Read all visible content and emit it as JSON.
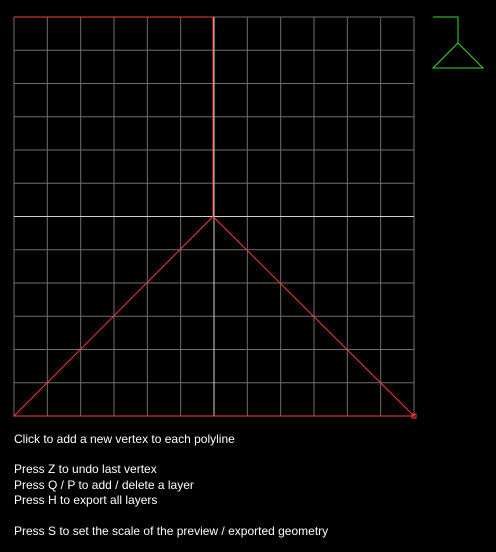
{
  "canvas": {
    "background": "#000000",
    "grid_color": "#6f6f6f",
    "axis_color": "#d0d0d0",
    "polyline_color": "#ff3b30",
    "grid_cells": 12
  },
  "preview": {
    "color": "#33dd33"
  },
  "instructions": {
    "line1": "Click to add a new vertex to each polyline",
    "line2": "Press Z to undo last vertex",
    "line3": "Press Q / P to add / delete a layer",
    "line4": "Press H to export all layers",
    "line5": "Press S to set the scale of the preview / exported geometry"
  }
}
